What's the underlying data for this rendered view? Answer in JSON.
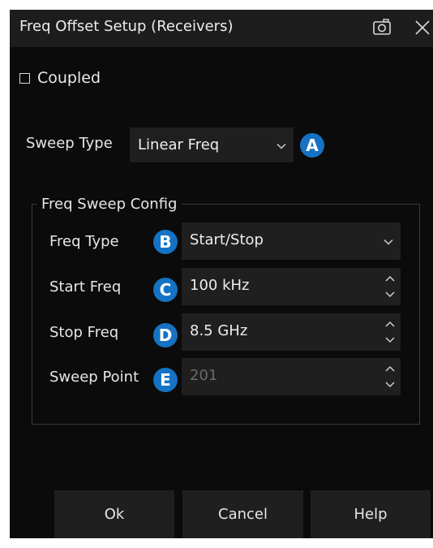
{
  "dialog": {
    "title": "Freq Offset Setup (Receivers)",
    "icons": [
      "screenshot-icon",
      "close-icon"
    ]
  },
  "coupled": {
    "label": "Coupled",
    "checked": false
  },
  "sweep_type": {
    "label": "Sweep Type",
    "value": "Linear Freq",
    "badge": "A"
  },
  "freq_sweep_config": {
    "title": "Freq Sweep Config",
    "freq_type": {
      "label": "Freq Type",
      "value": "Start/Stop",
      "badge": "B"
    },
    "start_freq": {
      "label": "Start Freq",
      "value": "100 kHz",
      "badge": "C"
    },
    "stop_freq": {
      "label": "Stop Freq",
      "value": "8.5 GHz",
      "badge": "D"
    },
    "sweep_point": {
      "label": "Sweep Point",
      "value": "201",
      "badge": "E",
      "enabled": false
    }
  },
  "buttons": {
    "ok": "Ok",
    "cancel": "Cancel",
    "help": "Help"
  },
  "colors": {
    "background": "#0b0b0b",
    "titlebar": "#1d1d1d",
    "control": "#1f1f1f",
    "badge": "#1572c4",
    "disabled_text": "#6a6a6a"
  }
}
